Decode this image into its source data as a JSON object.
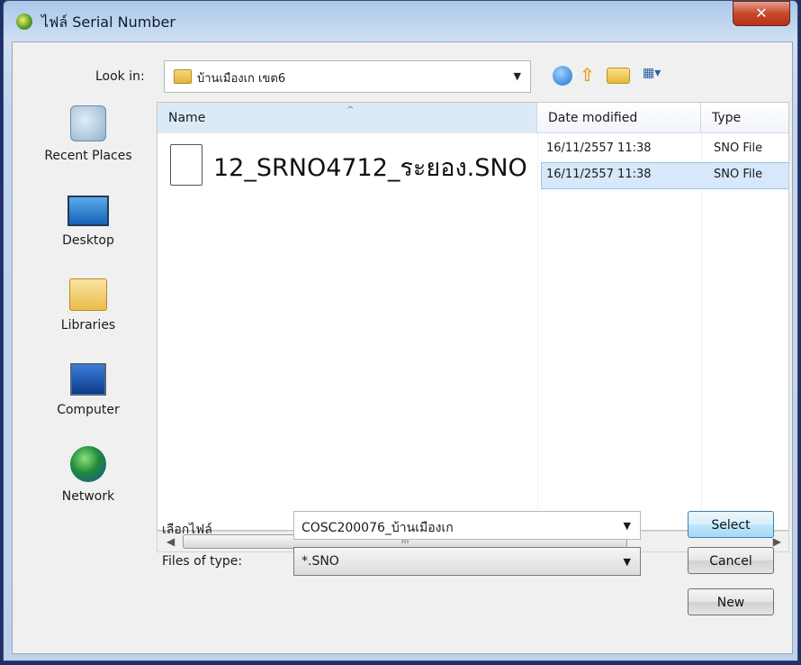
{
  "window": {
    "title": "ไฟล์ Serial Number",
    "close_glyph": "✕"
  },
  "toolbar": {
    "look_in_label": "Look in:",
    "look_in_value": "บ้านเมืองเก เขต6",
    "icons": [
      "back-icon",
      "up-folder-icon",
      "new-folder-icon",
      "views-menu-icon"
    ]
  },
  "places": [
    {
      "label": "Recent Places",
      "icon": "recent-places-icon"
    },
    {
      "label": "Desktop",
      "icon": "desktop-icon"
    },
    {
      "label": "Libraries",
      "icon": "libraries-icon"
    },
    {
      "label": "Computer",
      "icon": "computer-icon"
    },
    {
      "label": "Network",
      "icon": "network-icon"
    }
  ],
  "filelist": {
    "columns": {
      "name": "Name",
      "date": "Date modified",
      "type": "Type"
    },
    "rows": [
      {
        "name": "12_SRNO4712_ระยอง.SNO",
        "date": "16/11/2557 11:38",
        "type": "SNO File"
      },
      {
        "date": "16/11/2557 11:38",
        "type": "SNO File"
      }
    ],
    "scroll_thumb_glyph": "III"
  },
  "footer": {
    "filename_label": "เลือกไฟล์",
    "filename_value": "COSC200076_บ้านเมืองเก",
    "filetype_label": "Files of type:",
    "filetype_value": "*.SNO"
  },
  "buttons": {
    "select": "Select",
    "cancel": "Cancel",
    "new": "New"
  }
}
